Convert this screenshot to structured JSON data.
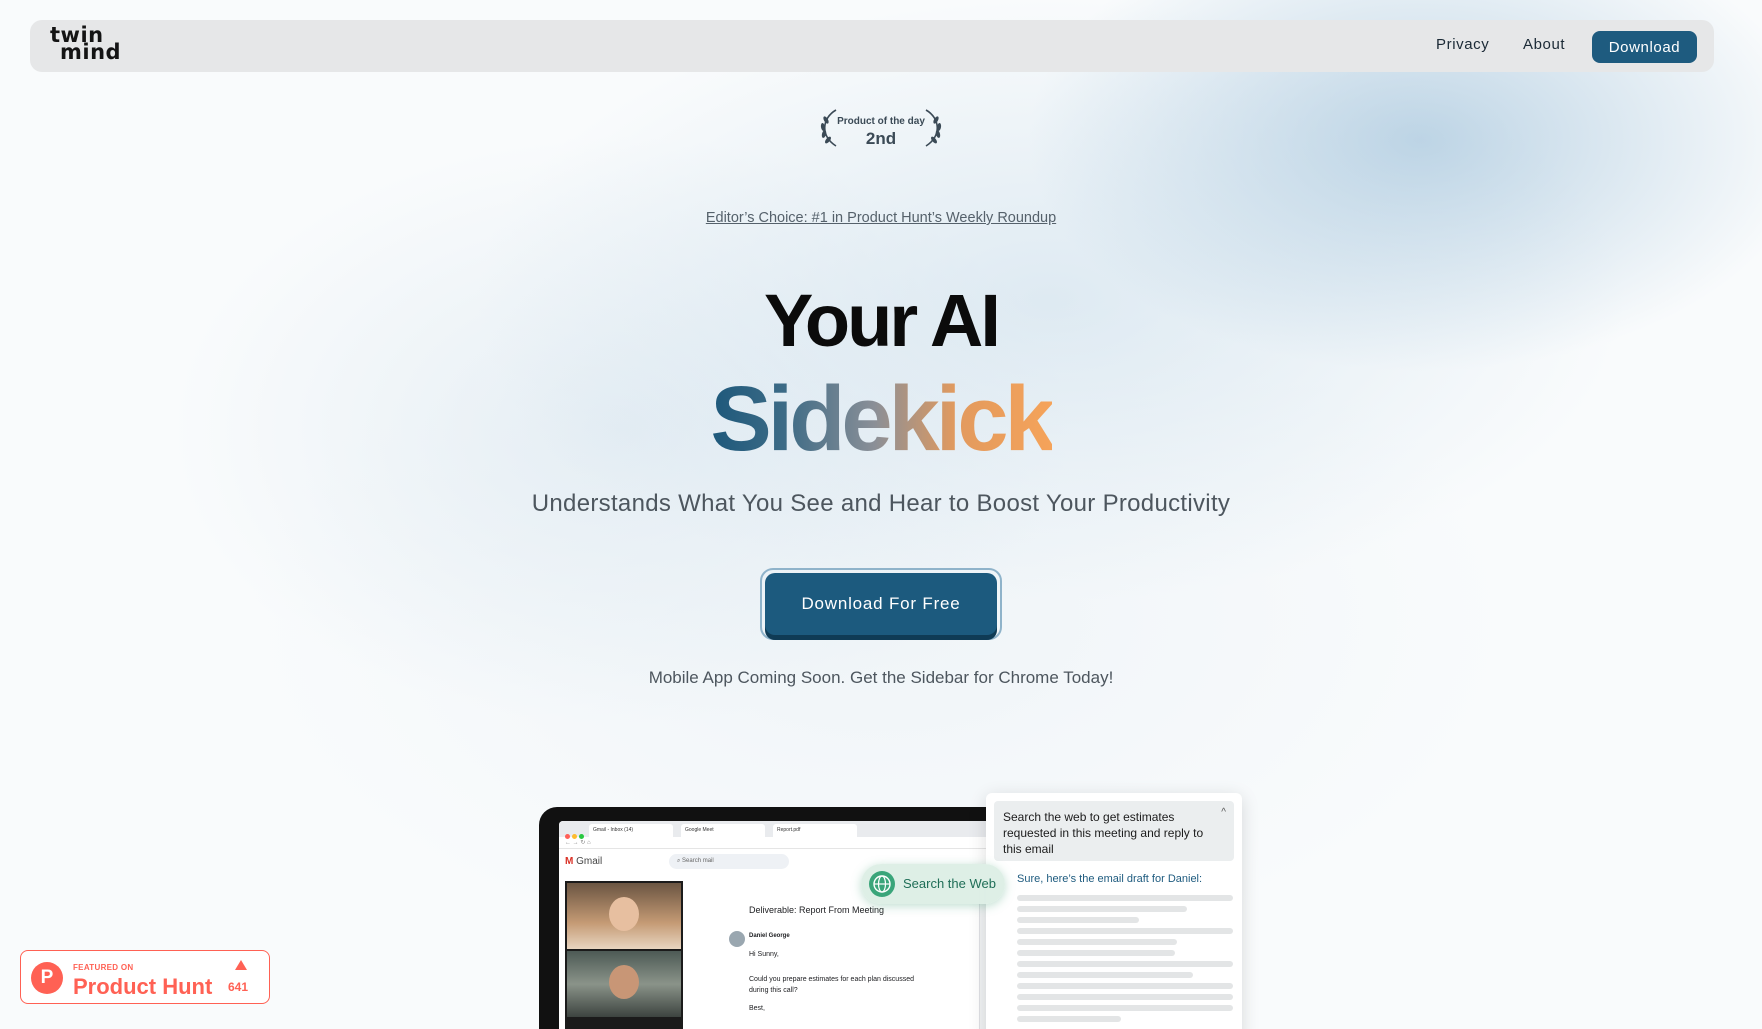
{
  "nav": {
    "logo_line1": "twin",
    "logo_line2": "mind",
    "privacy": "Privacy",
    "about": "About",
    "download": "Download"
  },
  "badge": {
    "subtitle": "Product of the day",
    "rank": "2nd"
  },
  "editor_choice": "Editor’s Choice: #1 in Product Hunt’s Weekly Roundup",
  "hero": {
    "headline_line1": "Your AI",
    "headline_line2": "Sidekick",
    "subtitle": "Understands What You See and Hear to Boost Your Productivity",
    "cta": "Download For Free",
    "mobile_note": "Mobile App Coming Soon. Get the Sidebar for Chrome Today!"
  },
  "mockup": {
    "tabs": [
      "Gmail - Inbox (14)",
      "Google Meet",
      "Report.pdf"
    ],
    "gmail_label": "Gmail",
    "search_placeholder": "Search mail",
    "email_subject": "Deliverable: Report From Meeting",
    "email_sender": "Daniel George",
    "email_greeting": "Hi Sunny,",
    "email_body": "Could you prepare estimates for each plan discussed during this call?",
    "email_signoff": "Best,",
    "search_web_pill": "Search the Web",
    "panel_query": "Search the web to get estimates requested in this meeting and reply to this email",
    "panel_answer": "Sure, here’s the email draft for Daniel:"
  },
  "product_hunt": {
    "featured": "FEATURED ON",
    "name": "Product Hunt",
    "votes": "641"
  },
  "colors": {
    "brand": "#1e5b7f",
    "accent_orange": "#f5a35a",
    "product_hunt": "#ff6154"
  }
}
